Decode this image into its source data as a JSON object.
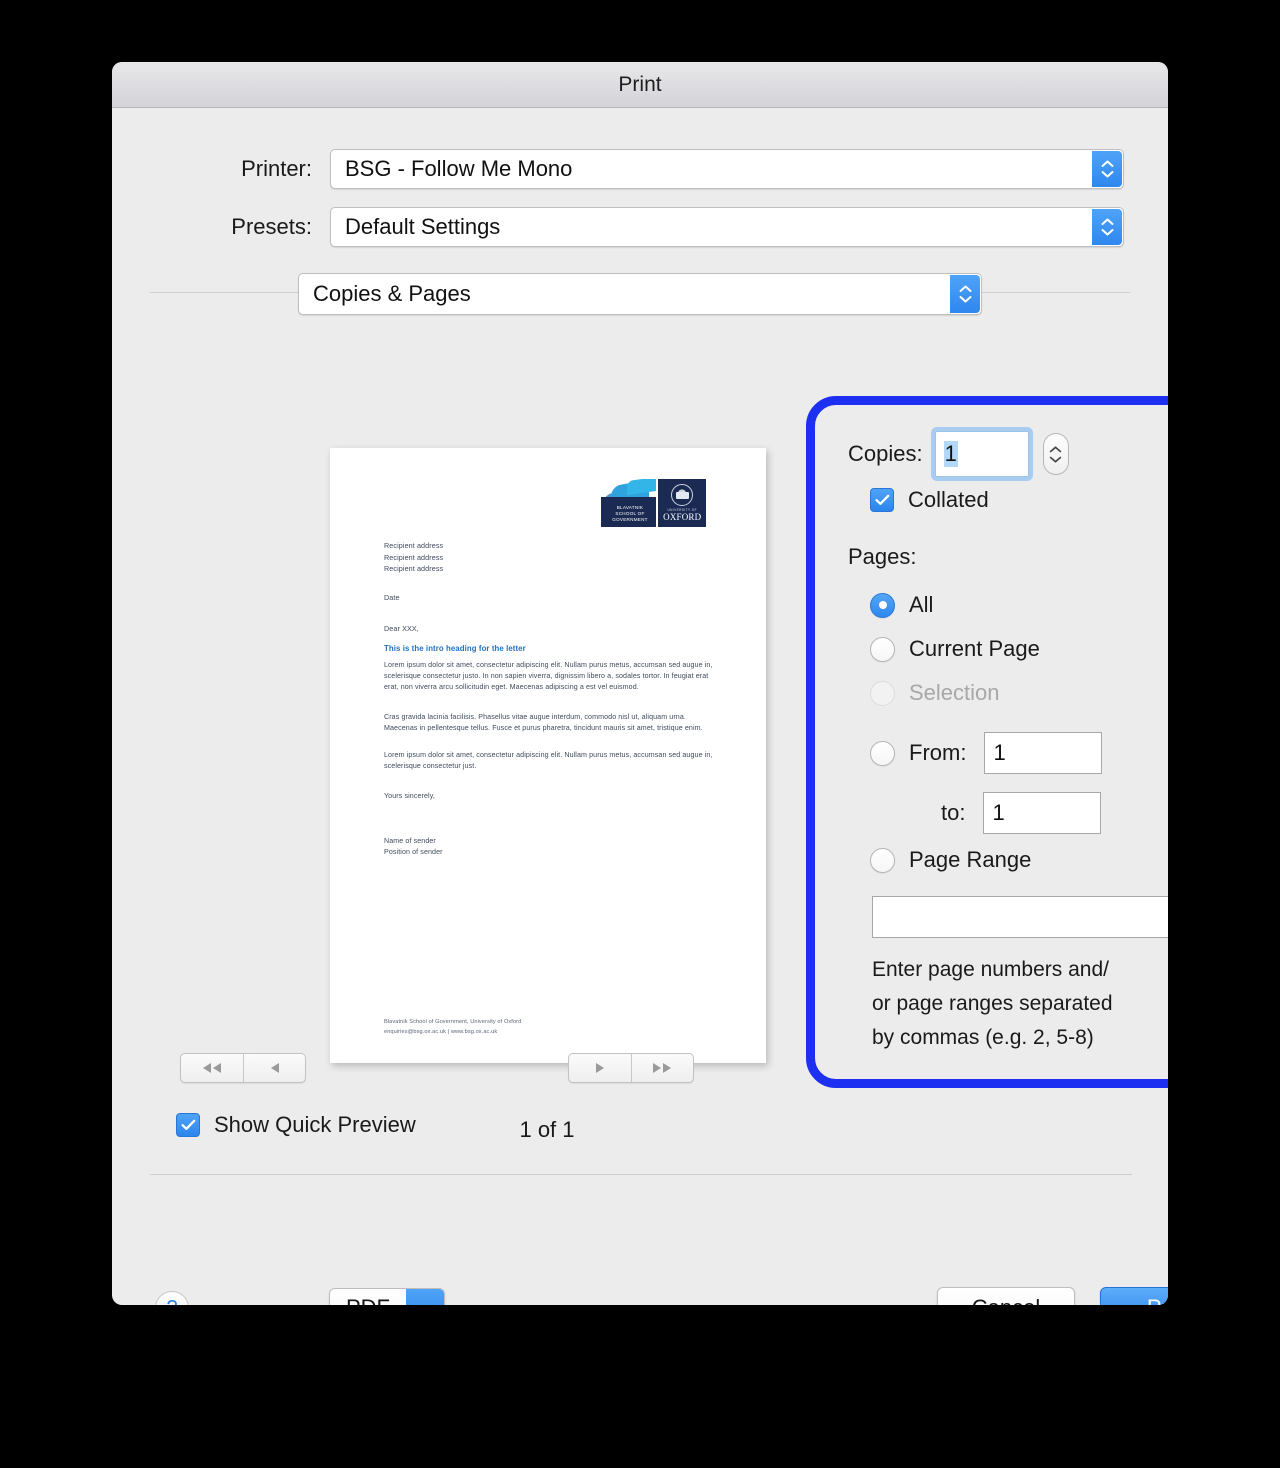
{
  "window": {
    "title": "Print"
  },
  "printer_row": {
    "label": "Printer:",
    "value": "BSG - Follow Me Mono"
  },
  "presets_row": {
    "label": "Presets:",
    "value": "Default Settings"
  },
  "pane_popup": {
    "value": "Copies & Pages"
  },
  "copies": {
    "label": "Copies:",
    "value": "1",
    "collated_label": "Collated",
    "collated_checked": true
  },
  "pages": {
    "label": "Pages:",
    "options": [
      {
        "label": "All",
        "selected": true,
        "disabled": false
      },
      {
        "label": "Current Page",
        "selected": false,
        "disabled": false
      },
      {
        "label": "Selection",
        "selected": false,
        "disabled": true
      },
      {
        "label": "From:",
        "selected": false,
        "disabled": false
      },
      {
        "label": "Page Range",
        "selected": false,
        "disabled": false
      }
    ],
    "from_value": "1",
    "to_label": "to:",
    "to_value": "1",
    "range_value": "",
    "hint": "Enter page numbers and/ or page ranges separated by commas (e.g. 2, 5-8)",
    "hint_line1": "Enter page numbers and/",
    "hint_line2": "or page ranges separated",
    "hint_line3": "by commas (e.g. 2, 5-8)"
  },
  "pager": {
    "first_icon": "rewind-icon",
    "prev_icon": "previous-icon",
    "next_icon": "next-icon",
    "last_icon": "fast-forward-icon",
    "indicator": "1 of 1"
  },
  "quick_preview": {
    "label": "Show Quick Preview",
    "checked": true
  },
  "footer": {
    "help_label": "?",
    "pdf_label": "PDF",
    "cancel_label": "Cancel",
    "print_label": "Print"
  },
  "preview_document": {
    "logo": {
      "bsg_line1": "BLAVATNIK",
      "bsg_line2": "SCHOOL OF",
      "bsg_line3": "GOVERNMENT",
      "ox_top": "UNIVERSITY OF",
      "ox_name": "OXFORD"
    },
    "recipient": [
      "Recipient address",
      "Recipient address",
      "Recipient address"
    ],
    "date": "Date",
    "salutation": "Dear XXX,",
    "heading": "This is the intro heading for the letter",
    "paragraphs": [
      "Lorem ipsum dolor sit amet, consectetur adipiscing elit. Nullam purus metus, accumsan sed augue in, scelerisque consectetur justo. In non sapien viverra, dignissim libero a, sodales tortor. In feugiat erat erat, non viverra arcu sollicitudin eget. Maecenas adipiscing a est vel euismod.",
      "Cras gravida lacinia facilisis. Phasellus vitae augue interdum, commodo nisl ut, aliquam urna. Maecenas in pellentesque tellus. Fusce et purus pharetra, tincidunt mauris sit amet, tristique enim.",
      "Lorem ipsum dolor sit amet, consectetur adipiscing elit. Nullam purus metus, accumsan sed augue in, scelerisque consectetur just."
    ],
    "closing": "Yours sincerely,",
    "sender_name": "Name of sender",
    "sender_position": "Position of sender",
    "footer_line1": "Blavatnik School of Government, University of Oxford",
    "footer_line2": "enquiries@bsg.ox.ac.uk  |  www.bsg.ox.ac.uk"
  },
  "colors": {
    "highlight_blue": "#1d2ff0",
    "accent_blue": "#2f87ef",
    "heading_blue": "#2272c0",
    "dialog_bg": "#ececec"
  }
}
